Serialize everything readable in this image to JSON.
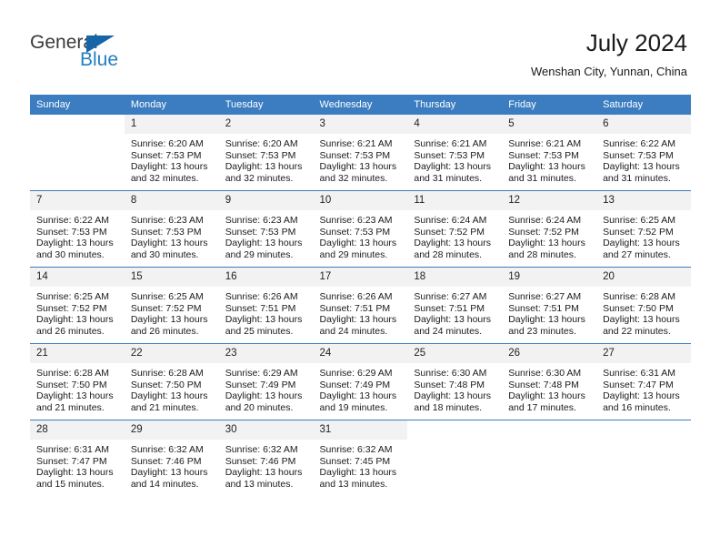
{
  "logo": {
    "primary_text": "General",
    "secondary_text": "Blue",
    "primary_color": "#3a3a3a",
    "secondary_color": "#1f7fc4",
    "triangle_color": "#1565a8"
  },
  "header": {
    "title": "July 2024",
    "subtitle": "Wenshan City, Yunnan, China"
  },
  "theme": {
    "header_bg": "#3b7dc0",
    "header_text": "#ffffff",
    "daynum_bg": "#f2f2f2",
    "cell_border": "#3b7dc0",
    "body_bg": "#ffffff"
  },
  "weekday_headers": [
    "Sunday",
    "Monday",
    "Tuesday",
    "Wednesday",
    "Thursday",
    "Friday",
    "Saturday"
  ],
  "weeks": [
    [
      {
        "day": "",
        "blank": true,
        "sunrise": "",
        "sunset": "",
        "daylight_line1": "",
        "daylight_line2": ""
      },
      {
        "day": "1",
        "sunrise": "Sunrise: 6:20 AM",
        "sunset": "Sunset: 7:53 PM",
        "daylight_line1": "Daylight: 13 hours",
        "daylight_line2": "and 32 minutes."
      },
      {
        "day": "2",
        "sunrise": "Sunrise: 6:20 AM",
        "sunset": "Sunset: 7:53 PM",
        "daylight_line1": "Daylight: 13 hours",
        "daylight_line2": "and 32 minutes."
      },
      {
        "day": "3",
        "sunrise": "Sunrise: 6:21 AM",
        "sunset": "Sunset: 7:53 PM",
        "daylight_line1": "Daylight: 13 hours",
        "daylight_line2": "and 32 minutes."
      },
      {
        "day": "4",
        "sunrise": "Sunrise: 6:21 AM",
        "sunset": "Sunset: 7:53 PM",
        "daylight_line1": "Daylight: 13 hours",
        "daylight_line2": "and 31 minutes."
      },
      {
        "day": "5",
        "sunrise": "Sunrise: 6:21 AM",
        "sunset": "Sunset: 7:53 PM",
        "daylight_line1": "Daylight: 13 hours",
        "daylight_line2": "and 31 minutes."
      },
      {
        "day": "6",
        "sunrise": "Sunrise: 6:22 AM",
        "sunset": "Sunset: 7:53 PM",
        "daylight_line1": "Daylight: 13 hours",
        "daylight_line2": "and 31 minutes."
      }
    ],
    [
      {
        "day": "7",
        "sunrise": "Sunrise: 6:22 AM",
        "sunset": "Sunset: 7:53 PM",
        "daylight_line1": "Daylight: 13 hours",
        "daylight_line2": "and 30 minutes."
      },
      {
        "day": "8",
        "sunrise": "Sunrise: 6:23 AM",
        "sunset": "Sunset: 7:53 PM",
        "daylight_line1": "Daylight: 13 hours",
        "daylight_line2": "and 30 minutes."
      },
      {
        "day": "9",
        "sunrise": "Sunrise: 6:23 AM",
        "sunset": "Sunset: 7:53 PM",
        "daylight_line1": "Daylight: 13 hours",
        "daylight_line2": "and 29 minutes."
      },
      {
        "day": "10",
        "sunrise": "Sunrise: 6:23 AM",
        "sunset": "Sunset: 7:53 PM",
        "daylight_line1": "Daylight: 13 hours",
        "daylight_line2": "and 29 minutes."
      },
      {
        "day": "11",
        "sunrise": "Sunrise: 6:24 AM",
        "sunset": "Sunset: 7:52 PM",
        "daylight_line1": "Daylight: 13 hours",
        "daylight_line2": "and 28 minutes."
      },
      {
        "day": "12",
        "sunrise": "Sunrise: 6:24 AM",
        "sunset": "Sunset: 7:52 PM",
        "daylight_line1": "Daylight: 13 hours",
        "daylight_line2": "and 28 minutes."
      },
      {
        "day": "13",
        "sunrise": "Sunrise: 6:25 AM",
        "sunset": "Sunset: 7:52 PM",
        "daylight_line1": "Daylight: 13 hours",
        "daylight_line2": "and 27 minutes."
      }
    ],
    [
      {
        "day": "14",
        "sunrise": "Sunrise: 6:25 AM",
        "sunset": "Sunset: 7:52 PM",
        "daylight_line1": "Daylight: 13 hours",
        "daylight_line2": "and 26 minutes."
      },
      {
        "day": "15",
        "sunrise": "Sunrise: 6:25 AM",
        "sunset": "Sunset: 7:52 PM",
        "daylight_line1": "Daylight: 13 hours",
        "daylight_line2": "and 26 minutes."
      },
      {
        "day": "16",
        "sunrise": "Sunrise: 6:26 AM",
        "sunset": "Sunset: 7:51 PM",
        "daylight_line1": "Daylight: 13 hours",
        "daylight_line2": "and 25 minutes."
      },
      {
        "day": "17",
        "sunrise": "Sunrise: 6:26 AM",
        "sunset": "Sunset: 7:51 PM",
        "daylight_line1": "Daylight: 13 hours",
        "daylight_line2": "and 24 minutes."
      },
      {
        "day": "18",
        "sunrise": "Sunrise: 6:27 AM",
        "sunset": "Sunset: 7:51 PM",
        "daylight_line1": "Daylight: 13 hours",
        "daylight_line2": "and 24 minutes."
      },
      {
        "day": "19",
        "sunrise": "Sunrise: 6:27 AM",
        "sunset": "Sunset: 7:51 PM",
        "daylight_line1": "Daylight: 13 hours",
        "daylight_line2": "and 23 minutes."
      },
      {
        "day": "20",
        "sunrise": "Sunrise: 6:28 AM",
        "sunset": "Sunset: 7:50 PM",
        "daylight_line1": "Daylight: 13 hours",
        "daylight_line2": "and 22 minutes."
      }
    ],
    [
      {
        "day": "21",
        "sunrise": "Sunrise: 6:28 AM",
        "sunset": "Sunset: 7:50 PM",
        "daylight_line1": "Daylight: 13 hours",
        "daylight_line2": "and 21 minutes."
      },
      {
        "day": "22",
        "sunrise": "Sunrise: 6:28 AM",
        "sunset": "Sunset: 7:50 PM",
        "daylight_line1": "Daylight: 13 hours",
        "daylight_line2": "and 21 minutes."
      },
      {
        "day": "23",
        "sunrise": "Sunrise: 6:29 AM",
        "sunset": "Sunset: 7:49 PM",
        "daylight_line1": "Daylight: 13 hours",
        "daylight_line2": "and 20 minutes."
      },
      {
        "day": "24",
        "sunrise": "Sunrise: 6:29 AM",
        "sunset": "Sunset: 7:49 PM",
        "daylight_line1": "Daylight: 13 hours",
        "daylight_line2": "and 19 minutes."
      },
      {
        "day": "25",
        "sunrise": "Sunrise: 6:30 AM",
        "sunset": "Sunset: 7:48 PM",
        "daylight_line1": "Daylight: 13 hours",
        "daylight_line2": "and 18 minutes."
      },
      {
        "day": "26",
        "sunrise": "Sunrise: 6:30 AM",
        "sunset": "Sunset: 7:48 PM",
        "daylight_line1": "Daylight: 13 hours",
        "daylight_line2": "and 17 minutes."
      },
      {
        "day": "27",
        "sunrise": "Sunrise: 6:31 AM",
        "sunset": "Sunset: 7:47 PM",
        "daylight_line1": "Daylight: 13 hours",
        "daylight_line2": "and 16 minutes."
      }
    ],
    [
      {
        "day": "28",
        "sunrise": "Sunrise: 6:31 AM",
        "sunset": "Sunset: 7:47 PM",
        "daylight_line1": "Daylight: 13 hours",
        "daylight_line2": "and 15 minutes."
      },
      {
        "day": "29",
        "sunrise": "Sunrise: 6:32 AM",
        "sunset": "Sunset: 7:46 PM",
        "daylight_line1": "Daylight: 13 hours",
        "daylight_line2": "and 14 minutes."
      },
      {
        "day": "30",
        "sunrise": "Sunrise: 6:32 AM",
        "sunset": "Sunset: 7:46 PM",
        "daylight_line1": "Daylight: 13 hours",
        "daylight_line2": "and 13 minutes."
      },
      {
        "day": "31",
        "sunrise": "Sunrise: 6:32 AM",
        "sunset": "Sunset: 7:45 PM",
        "daylight_line1": "Daylight: 13 hours",
        "daylight_line2": "and 13 minutes."
      },
      {
        "day": "",
        "blank": true,
        "sunrise": "",
        "sunset": "",
        "daylight_line1": "",
        "daylight_line2": ""
      },
      {
        "day": "",
        "blank": true,
        "sunrise": "",
        "sunset": "",
        "daylight_line1": "",
        "daylight_line2": ""
      },
      {
        "day": "",
        "blank": true,
        "sunrise": "",
        "sunset": "",
        "daylight_line1": "",
        "daylight_line2": ""
      }
    ]
  ]
}
